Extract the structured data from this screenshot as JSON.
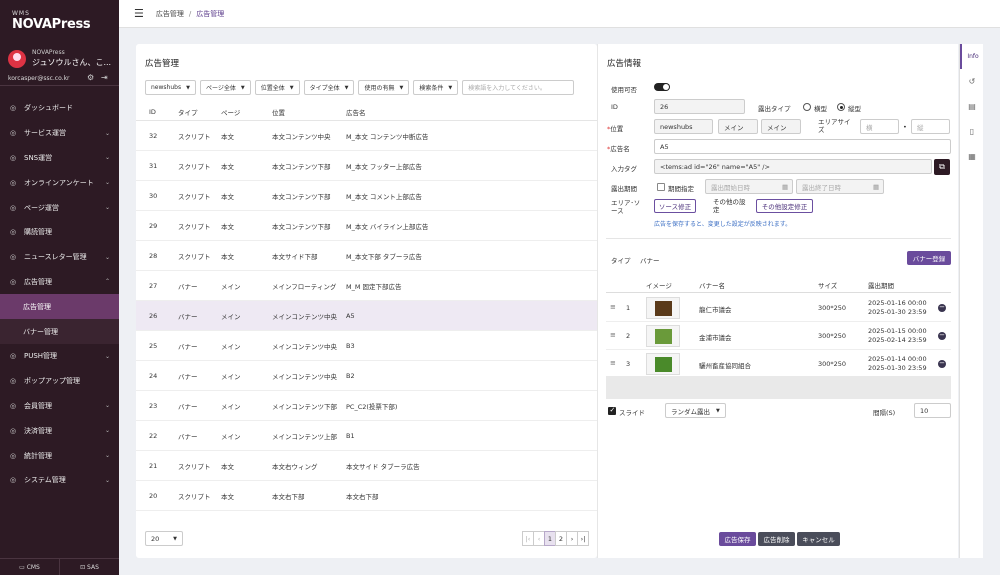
{
  "sidebar": {
    "brand_small": "WMS",
    "brand_main": "NOVAPress",
    "user_sub": "NOVAPress",
    "user_name": "ジュソウルさん、こ...",
    "user_email": "korcasper@ssc.co.kr",
    "items": [
      {
        "label": "ダッシュボード",
        "icon": "dashboard-icon"
      },
      {
        "label": "サービス運営",
        "icon": "service-icon",
        "chevron": "⌄"
      },
      {
        "label": "SNS運営",
        "icon": "sns-icon",
        "chevron": "⌄"
      },
      {
        "label": "オンラインアンケート",
        "icon": "survey-icon",
        "chevron": "⌄"
      },
      {
        "label": "ページ運営",
        "icon": "page-icon",
        "chevron": "⌄"
      },
      {
        "label": "購読管理",
        "icon": "subscription-icon"
      },
      {
        "label": "ニュースレター管理",
        "icon": "newsletter-icon",
        "chevron": "⌄"
      },
      {
        "label": "広告管理",
        "icon": "ad-icon",
        "chevron": "⌃"
      }
    ],
    "subitems": [
      {
        "label": "広告管理"
      },
      {
        "label": "バナー管理"
      }
    ],
    "items2": [
      {
        "label": "PUSH管理",
        "icon": "push-icon",
        "chevron": "⌄"
      },
      {
        "label": "ポップアップ管理",
        "icon": "popup-icon"
      },
      {
        "label": "会員管理",
        "icon": "member-icon",
        "chevron": "⌄"
      },
      {
        "label": "決済管理",
        "icon": "payment-icon",
        "chevron": "⌄"
      },
      {
        "label": "統計管理",
        "icon": "stats-icon",
        "chevron": "⌄"
      },
      {
        "label": "システム管理",
        "icon": "system-icon",
        "chevron": "⌄"
      }
    ],
    "footer_cms": "CMS",
    "footer_sas": "SAS"
  },
  "topbar": {
    "crumb1": "広告管理",
    "crumb_sep": "/",
    "crumb2": "広告管理"
  },
  "list": {
    "title": "広告管理",
    "filters": [
      "newshubs",
      "ページ全体",
      "位置全体",
      "タイプ全体",
      "使用の有無",
      "検索条件"
    ],
    "search_placeholder": "検索語を入力してください。",
    "headers": [
      "ID",
      "タイプ",
      "ページ",
      "位置",
      "広告名"
    ],
    "rows": [
      [
        "32",
        "スクリプト",
        "本文",
        "本文コンテンツ中央",
        "M_本文 コンテンツ中断広告"
      ],
      [
        "31",
        "スクリプト",
        "本文",
        "本文コンテンツ下部",
        "M_本文 フッター上部広告"
      ],
      [
        "30",
        "スクリプト",
        "本文",
        "本文コンテンツ下部",
        "M_本文 コメント上部広告"
      ],
      [
        "29",
        "スクリプト",
        "本文",
        "本文コンテンツ下部",
        "M_本文 バイライン上部広告"
      ],
      [
        "28",
        "スクリプト",
        "本文",
        "本文サイド下部",
        "M_本文下部 タブーラ広告"
      ],
      [
        "27",
        "バナー",
        "メイン",
        "メインフローティング",
        "M_M 固定下部広告"
      ],
      [
        "26",
        "バナー",
        "メイン",
        "メインコンテンツ中央",
        "A5"
      ],
      [
        "25",
        "バナー",
        "メイン",
        "メインコンテンツ中央",
        "B3"
      ],
      [
        "24",
        "バナー",
        "メイン",
        "メインコンテンツ中央",
        "B2"
      ],
      [
        "23",
        "バナー",
        "メイン",
        "メインコンテンツ下部",
        "PC_C2(投票下部)"
      ],
      [
        "22",
        "バナー",
        "メイン",
        "メインコンテンツ上部",
        "B1"
      ],
      [
        "21",
        "スクリプト",
        "本文",
        "本文右ウィング",
        "本文サイド タブーラ広告"
      ],
      [
        "20",
        "スクリプト",
        "本文",
        "本文右下部",
        "本文右下部"
      ]
    ],
    "page_size": "20",
    "pages": [
      "|‹",
      "‹",
      "1",
      "2",
      "›",
      "›|"
    ]
  },
  "detail": {
    "title": "広告情報",
    "label_use": "使用可否",
    "label_id": "ID",
    "id_value": "26",
    "label_exposure_type": "露出タイプ",
    "radio_horizontal": "横型",
    "radio_vertical": "縦型",
    "label_position": "位置",
    "pos_values": [
      "newshubs",
      "メイン",
      "メイン"
    ],
    "label_area_size": "エリアサイズ",
    "width_placeholder": "横",
    "height_placeholder": "縦",
    "size_sep": "•",
    "label_ad_name": "広告名",
    "ad_name": "A5",
    "label_input_tag": "入力タグ",
    "input_tag": "<tems:ad id=\"26\" name=\"A5\" />",
    "label_exposure_period": "露出期間",
    "period_check_label": "期間指定",
    "start_placeholder": "露出開始日時",
    "end_placeholder": "露出終了日時",
    "label_area_source": "エリア･ソース",
    "btn_source_edit": "ソース修正",
    "other_settings": "その他の設定",
    "btn_other_edit": "その他設定修正",
    "note": "広告を保存すると、変更した設定が反映されます。",
    "label_type": "タイプ",
    "type_value": "バナー",
    "btn_banner_register": "バナー登録",
    "banner_headers": [
      "イメージ",
      "バナー名",
      "サイズ",
      "露出期間"
    ],
    "banners": [
      {
        "no": "1",
        "name": "龍仁市議会",
        "size": "300*250",
        "start": "2025-01-16 00:00",
        "end": "2025-01-30 23:59",
        "color": "#5a3a1a"
      },
      {
        "no": "2",
        "name": "金浦市議会",
        "size": "300*250",
        "start": "2025-01-15 00:00",
        "end": "2025-02-14 23:59",
        "color": "#6a9a3a"
      },
      {
        "no": "3",
        "name": "驪州畜産協同組合",
        "size": "300*250",
        "start": "2025-01-14 00:00",
        "end": "2025-01-30 23:59",
        "color": "#4a8a2a"
      }
    ],
    "slide_label": "スライド",
    "random_label": "ランダム露出",
    "interval_label": "間隔(S)",
    "interval_value": "10",
    "btn_save": "広告保存",
    "btn_delete": "広告削除",
    "btn_cancel": "キャンセル"
  },
  "right_tabs": {
    "info": "Info"
  }
}
